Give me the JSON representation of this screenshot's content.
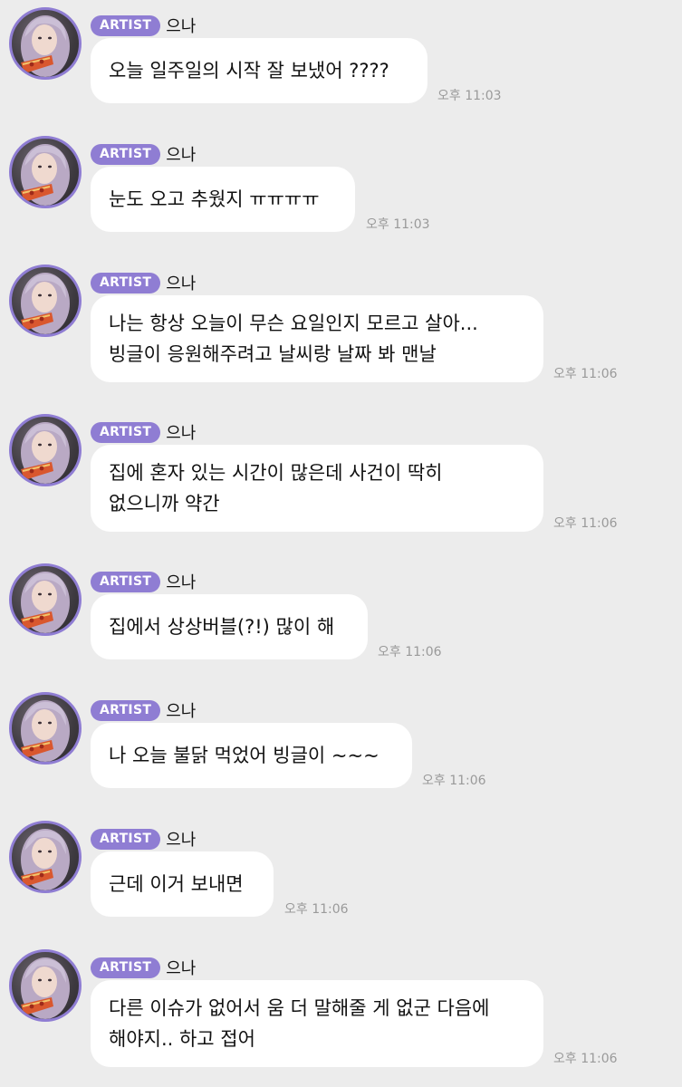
{
  "messages": [
    {
      "badge": "ARTIST",
      "sender": "으나",
      "text": "오늘 일주일의 시작 잘 보냈어 ????",
      "time": "오후 11:03"
    },
    {
      "badge": "ARTIST",
      "sender": "으나",
      "text": "눈도 오고 추웠지 ㅠㅠㅠㅠ",
      "time": "오후 11:03"
    },
    {
      "badge": "ARTIST",
      "sender": "으나",
      "text": "나는 항상 오늘이 무슨 요일인지 모르고 살아...\n빙글이 응원해주려고 날씨랑 날짜 봐 맨날",
      "time": "오후 11:06"
    },
    {
      "badge": "ARTIST",
      "sender": "으나",
      "text": "집에 혼자 있는 시간이 많은데 사건이 딱히\n없으니까 약간",
      "time": "오후 11:06"
    },
    {
      "badge": "ARTIST",
      "sender": "으나",
      "text": "집에서 상상버블(?!) 많이 해",
      "time": "오후 11:06"
    },
    {
      "badge": "ARTIST",
      "sender": "으나",
      "text": "나 오늘 불닭 먹었어 빙글이 ~~~",
      "time": "오후 11:06"
    },
    {
      "badge": "ARTIST",
      "sender": "으나",
      "text": "근데 이거 보내면",
      "time": "오후 11:06"
    },
    {
      "badge": "ARTIST",
      "sender": "으나",
      "text": "다른 이슈가 없어서 움 더 말해줄 게 없군 다음에\n해야지.. 하고 접어",
      "time": "오후 11:06"
    }
  ]
}
